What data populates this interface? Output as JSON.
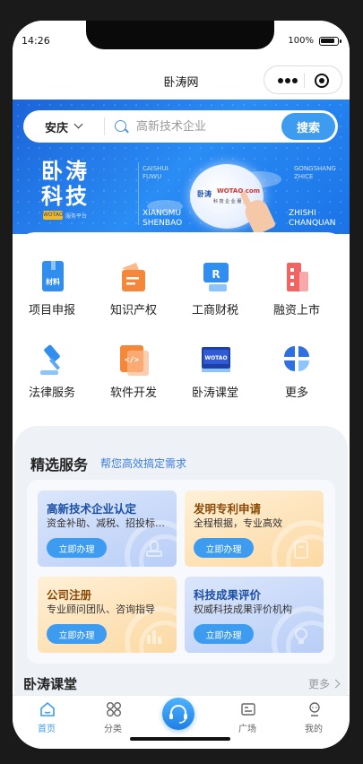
{
  "status": {
    "time": "14:26",
    "battery": "100%"
  },
  "nav": {
    "title": "卧涛网"
  },
  "search": {
    "city": "安庆",
    "placeholder": "高新技术企业",
    "button": "搜索"
  },
  "banner": {
    "brand_line1": "卧涛",
    "brand_line2": "科技",
    "brand_tag_en": "WOTAO",
    "brand_tag_cn": "服务平台",
    "label_caishui": "CAISHUI FUWU",
    "label_gongshang": "GONGSHANG ZHICE",
    "label_xiangmu": "XIANGMU SHENBAO",
    "label_zhishi": "ZHISHI CHANQUAN",
    "logo_cn": "卧涛",
    "logo_en": "WOTAO.com",
    "logo_sub": "科 技 企 业 服 务"
  },
  "grid": [
    {
      "label": "项目申报",
      "icon": "project-declare-icon"
    },
    {
      "label": "知识产权",
      "icon": "intellectual-property-icon"
    },
    {
      "label": "工商财税",
      "icon": "business-tax-icon"
    },
    {
      "label": "融资上市",
      "icon": "financing-listing-icon"
    },
    {
      "label": "法律服务",
      "icon": "legal-service-icon"
    },
    {
      "label": "软件开发",
      "icon": "software-dev-icon"
    },
    {
      "label": "卧涛课堂",
      "icon": "classroom-icon"
    },
    {
      "label": "更多",
      "icon": "more-grid-icon"
    }
  ],
  "services": {
    "title": "精选服务",
    "subtitle": "帮您高效搞定需求",
    "cards": [
      {
        "title": "高新技术企业认定",
        "desc": "资金补助、减税、招投标加分",
        "button": "立即办理",
        "theme": "blue"
      },
      {
        "title": "发明专利申请",
        "desc": "全程根据，专业高效",
        "button": "立即办理",
        "theme": "orange"
      },
      {
        "title": "公司注册",
        "desc": "专业顾问团队、咨询指导",
        "button": "立即办理",
        "theme": "orange"
      },
      {
        "title": "科技成果评价",
        "desc": "权威科技成果评价机构",
        "button": "立即办理",
        "theme": "blue"
      }
    ]
  },
  "course": {
    "title": "卧涛课堂",
    "more": "更多"
  },
  "tabs": [
    {
      "label": "首页",
      "icon": "home-icon",
      "active": true
    },
    {
      "label": "分类",
      "icon": "category-icon",
      "active": false
    },
    {
      "label": "",
      "icon": "customer-service-icon",
      "active": false
    },
    {
      "label": "广场",
      "icon": "square-icon",
      "active": false
    },
    {
      "label": "我的",
      "icon": "profile-icon",
      "active": false
    }
  ],
  "colors": {
    "accent": "#3d9bf0",
    "banner": "#1b63d8",
    "brand_text": "#1a4fa6"
  }
}
